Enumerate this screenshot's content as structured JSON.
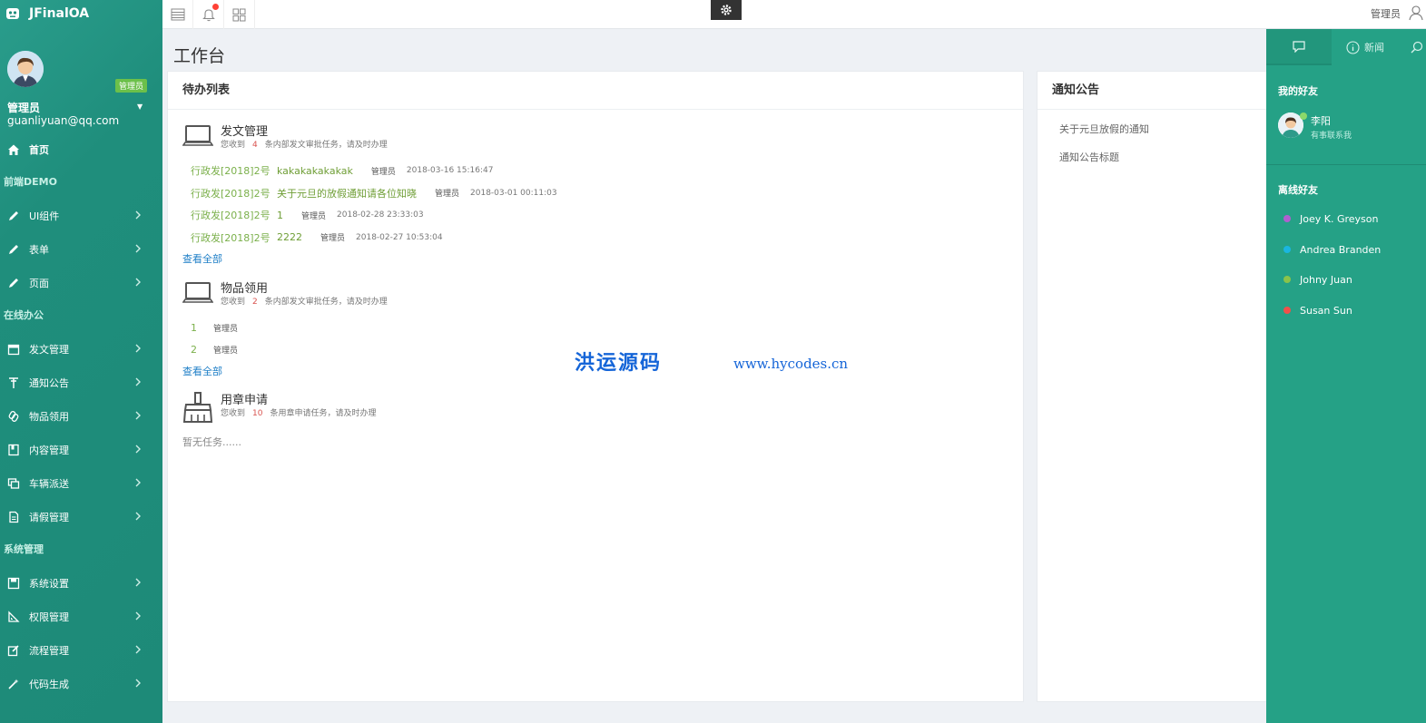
{
  "app": {
    "title": "JFinalOA"
  },
  "profile": {
    "role_badge": "管理员",
    "name": "管理员",
    "email": "guanliyuan@qq.com"
  },
  "sidebar": {
    "home": "首页",
    "section_demo": "前端DEMO",
    "demo_items": [
      "UI组件",
      "表单",
      "页面"
    ],
    "section_office": "在线办公",
    "office_items": [
      "发文管理",
      "通知公告",
      "物品领用",
      "内容管理",
      "车辆派送",
      "请假管理"
    ],
    "section_system": "系统管理",
    "system_items": [
      "系统设置",
      "权限管理",
      "流程管理",
      "代码生成"
    ]
  },
  "topbar": {
    "user": "管理员"
  },
  "page": {
    "title": "工作台"
  },
  "todo": {
    "title": "待办列表",
    "view_all": "查看全部",
    "groups": [
      {
        "title": "发文管理",
        "sub_prefix": "您收到",
        "count": "4",
        "sub_suffix": "条内部发文审批任务，请及时办理",
        "rows": [
          {
            "doc": "行政发[2018]2号",
            "subject": "kakakakakakak",
            "user": "管理员",
            "time": "2018-03-16 15:16:47"
          },
          {
            "doc": "行政发[2018]2号",
            "subject": "关于元旦的放假通知请各位知晓",
            "user": "管理员",
            "time": "2018-03-01 00:11:03"
          },
          {
            "doc": "行政发[2018]2号",
            "subject": "1",
            "user": "管理员",
            "time": "2018-02-28 23:33:03"
          },
          {
            "doc": "行政发[2018]2号",
            "subject": "2222",
            "user": "管理员",
            "time": "2018-02-27 10:53:04"
          }
        ]
      },
      {
        "title": "物品领用",
        "sub_prefix": "您收到",
        "count": "2",
        "sub_suffix": "条内部发文审批任务，请及时办理",
        "rows": [
          {
            "doc": "1",
            "user": "管理员"
          },
          {
            "doc": "2",
            "user": "管理员"
          }
        ]
      },
      {
        "title": "用章申请",
        "sub_prefix": "您收到",
        "count": "10",
        "sub_suffix": "条用章申请任务，请及时办理",
        "empty": "暂无任务......"
      }
    ]
  },
  "notice": {
    "title": "通知公告",
    "items": [
      "关于元旦放假的通知",
      "通知公告标题"
    ]
  },
  "watermark": {
    "cn": "洪运源码",
    "url": "www.hycodes.cn"
  },
  "rightbar": {
    "tab_news": "新闻",
    "my_friends": "我的好友",
    "friend": {
      "name": "李阳",
      "status": "有事联系我"
    },
    "offline_title": "离线好友",
    "offline": [
      {
        "name": "Joey K. Greyson",
        "color": "#b05fd0"
      },
      {
        "name": "Andrea Branden",
        "color": "#1ab6e0"
      },
      {
        "name": "Johny Juan",
        "color": "#8bc34a"
      },
      {
        "name": "Susan Sun",
        "color": "#f0504a"
      }
    ]
  },
  "colors": {
    "sidebar": "#1f8e7c",
    "rightbar": "#25a186",
    "link": "#1f7fc7",
    "badge": "#6cc04a"
  },
  "icons": [
    "bars-icon",
    "bell-icon",
    "grid-icon",
    "gear-icon",
    "user-icon",
    "chat-icon",
    "info-icon",
    "search-icon",
    "laptop-icon",
    "broom-icon",
    "home-icon",
    "pencil-icon",
    "calendar-icon",
    "antenna-icon",
    "link-icon",
    "book-icon",
    "copy-icon",
    "file-icon",
    "save-icon",
    "ruler-icon",
    "edit-icon",
    "wand-icon",
    "chevron-right-icon"
  ]
}
